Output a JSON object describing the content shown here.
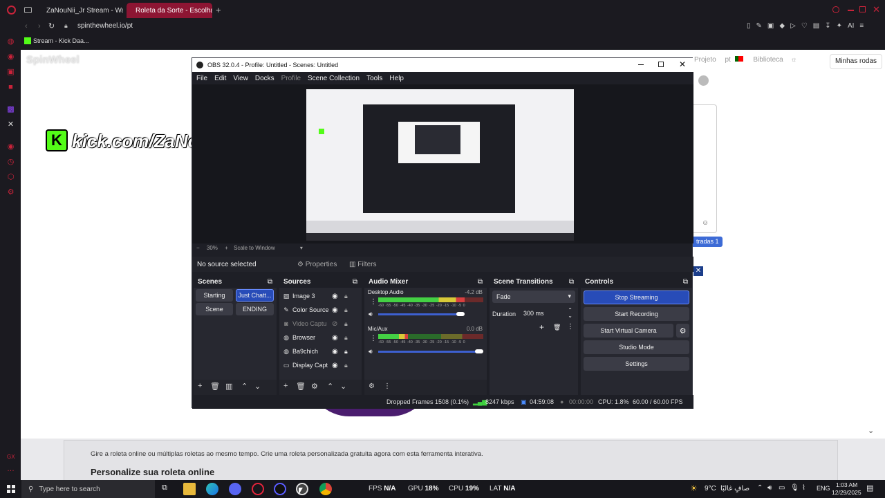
{
  "browser": {
    "tabs": [
      {
        "label": "ZaNouNii_Jr Stream - Wat"
      },
      {
        "label": "Roleta da Sorte - Escolha"
      }
    ],
    "address": "spinthewheel.io/pt",
    "bookmark": "Stream - Kick Daa...",
    "extension_label": "AI"
  },
  "page": {
    "logo": "SpinWheel",
    "overlay_text": "kick.com/ZaNouNii_Jr",
    "nav": {
      "project": "Projeto",
      "lang": "pt",
      "library": "Biblioteca",
      "my_wheels": "Minhas rodas"
    },
    "entries_badge": "tradas 1",
    "description": "Gire a roleta online ou múltiplas roletas ao mesmo tempo. Crie uma roleta personalizada gratuita agora com esta ferramenta interativa.",
    "heading": "Personalize sua roleta online"
  },
  "obs": {
    "title": "OBS 32.0.4 - Profile: Untitled - Scenes: Untitled",
    "menu": [
      "File",
      "Edit",
      "View",
      "Docks",
      "Profile",
      "Scene Collection",
      "Tools",
      "Help"
    ],
    "zoom": "30%",
    "zoom_mode": "Scale to Window",
    "no_source": "No source selected",
    "properties": "Properties",
    "filters": "Filters",
    "docks": {
      "scenes": "Scenes",
      "sources": "Sources",
      "audio": "Audio Mixer",
      "transitions": "Scene Transitions",
      "controls": "Controls"
    },
    "scenes": [
      "Starting",
      "Just Chatt...",
      "Scene",
      "ENDING"
    ],
    "sources": [
      {
        "name": "Image 3",
        "icon": "image-icon"
      },
      {
        "name": "Color Source",
        "icon": "brush-icon"
      },
      {
        "name": "Video Captu",
        "icon": "camera-icon"
      },
      {
        "name": "Browser",
        "icon": "globe-icon"
      },
      {
        "name": "Ba9chich",
        "icon": "globe-icon"
      },
      {
        "name": "Display Capt",
        "icon": "monitor-icon"
      }
    ],
    "audio": [
      {
        "name": "Desktop Audio",
        "db": "-4.2 dB",
        "level": 0.82,
        "volume": 0.95
      },
      {
        "name": "Mic/Aux",
        "db": "0.0 dB",
        "level": 0.28,
        "volume": 1.0
      }
    ],
    "meter_scale": "-60 -55 -50 -45 -40 -35 -30 -25 -20 -15 -10 -5 0",
    "transition": {
      "type": "Fade",
      "duration_label": "Duration",
      "duration": "300 ms"
    },
    "controls": [
      "Stop Streaming",
      "Start Recording",
      "Start Virtual Camera",
      "Studio Mode",
      "Settings"
    ],
    "status": {
      "dropped": "Dropped Frames 1508 (0.1%)",
      "kbps": "8247 kbps",
      "live": "04:59:08",
      "rec": "00:00:00",
      "cpu": "CPU: 1.8%",
      "fps": "60.00 / 60.00 FPS"
    }
  },
  "taskbar": {
    "search": "Type here to search",
    "stats": [
      {
        "label": "FPS",
        "value": "N/A"
      },
      {
        "label": "GPU",
        "value": "18%"
      },
      {
        "label": "CPU",
        "value": "19%"
      },
      {
        "label": "LAT",
        "value": "N/A"
      }
    ],
    "weather": "9°C",
    "weather_text": "صافٍ غالبًا",
    "lang": "ENG",
    "time": "1:03 AM",
    "date": "12/29/2025"
  }
}
